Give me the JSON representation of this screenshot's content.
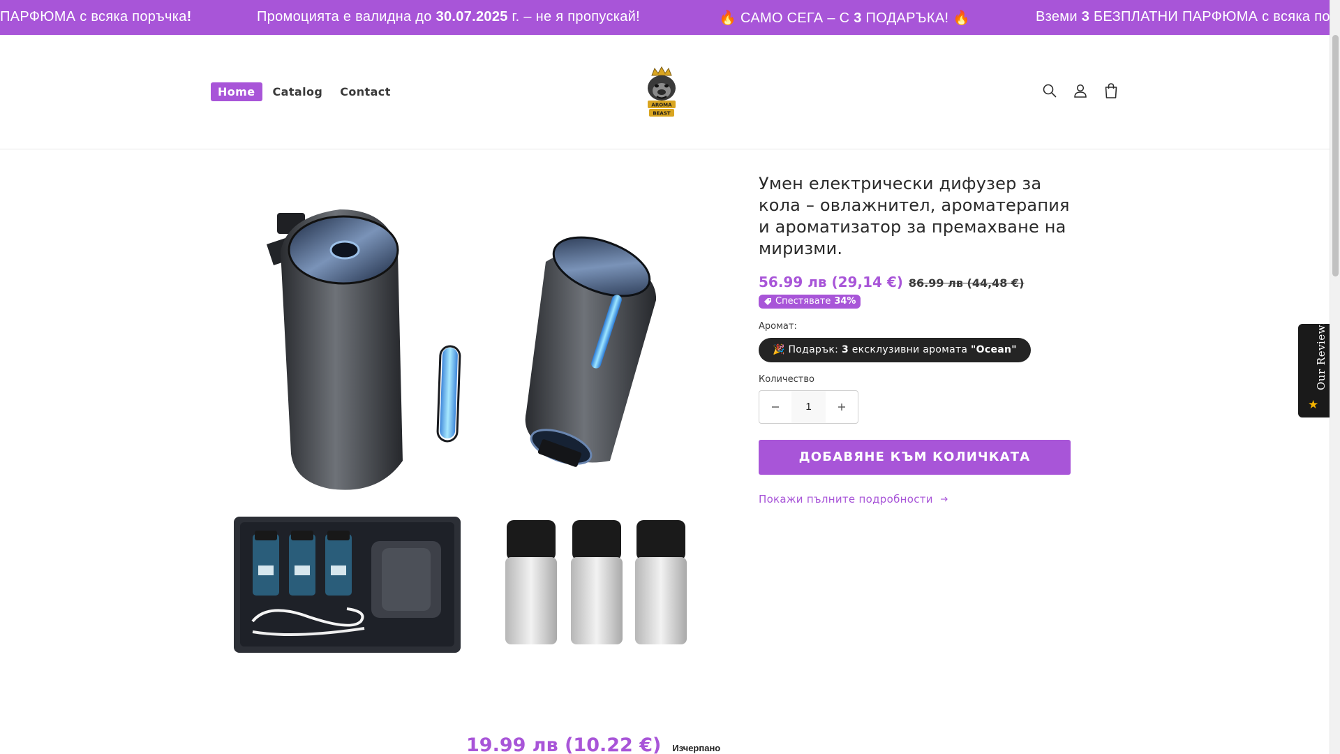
{
  "announcement": {
    "messages": [
      {
        "pre": "ПАРФЮМА с всяка поръчка",
        "bold": "!",
        "post": ""
      },
      {
        "pre": "Промоцията е валидна до ",
        "bold": "30.07.2025",
        "post": " г. – не я пропускай!"
      },
      {
        "pre": "🔥 САМО СЕГА – С ",
        "bold": "3",
        "post": " ПОДАРЪКА! 🔥"
      },
      {
        "pre": "Вземи ",
        "bold": "3",
        "post": " БЕЗПЛАТНИ ПАРФЮМА с всяка пор"
      }
    ]
  },
  "nav": {
    "items": [
      {
        "label": "Home",
        "active": true
      },
      {
        "label": "Catalog",
        "active": false
      },
      {
        "label": "Contact",
        "active": false
      }
    ]
  },
  "logo": {
    "text_line1": "AROMA",
    "text_line2": "BEAST"
  },
  "header_icons": [
    "search-icon",
    "account-icon",
    "cart-icon"
  ],
  "product": {
    "title": "Умен електрически дифузер за кола – овлажнител, ароматерапия и ароматизатор за премахване на миризми.",
    "price_now": "56.99 лв (29,14 €)",
    "price_was": "86.99 лв (44,48 €)",
    "badge_label": "Спестявате",
    "badge_value": "34%",
    "aroma_label": "Аромат:",
    "aroma_option": {
      "pre": "🎉 Подарък: ",
      "bold_num": "3",
      "mid": " ексклузивни аромата ",
      "bold_name": "\"Ocean\""
    },
    "quantity_label": "Количество",
    "quantity_value": "1",
    "add_to_cart": "ДОБАВЯНЕ КЪМ КОЛИЧКАТА",
    "details_link": "Покажи пълните подробности"
  },
  "reviews_tab": {
    "label": "Our Reviews"
  },
  "sticky": {
    "price": "19.99 лв (10.22 €)",
    "status": "Изчерпано"
  },
  "colors": {
    "accent": "#a855d8",
    "dark": "#242424"
  }
}
